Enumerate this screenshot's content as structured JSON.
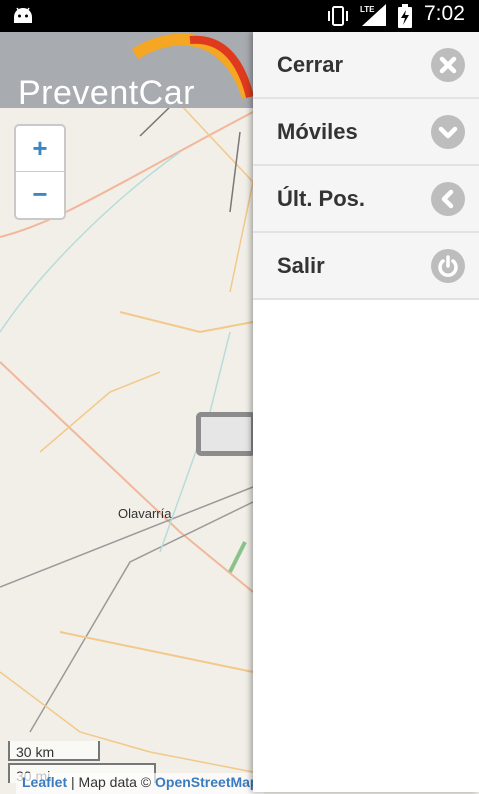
{
  "status_bar": {
    "time": "7:02",
    "network": "LTE"
  },
  "header": {
    "brand": "PreventCar"
  },
  "map": {
    "zoom_in_label": "+",
    "zoom_out_label": "−",
    "city_label": "Olavarría",
    "scale_km": "30 km",
    "scale_mi": "30 mi",
    "attribution": {
      "leaflet": "Leaflet",
      "separator": " | Map data © ",
      "osm": "OpenStreetMap"
    }
  },
  "menu": {
    "items": [
      {
        "label": "Cerrar",
        "icon": "close-circle-icon"
      },
      {
        "label": "Móviles",
        "icon": "chevron-down-circle-icon"
      },
      {
        "label": "Últ. Pos.",
        "icon": "chevron-left-circle-icon"
      },
      {
        "label": "Salir",
        "icon": "power-circle-icon"
      }
    ]
  },
  "colors": {
    "menu_bg": "#f5f5f5",
    "icon_bg": "#bdbdbd",
    "zoom_text": "#3a86c8",
    "header_bg": "#a8abb0"
  }
}
